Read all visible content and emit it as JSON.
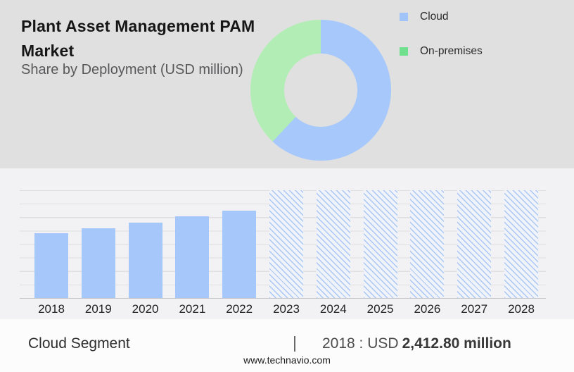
{
  "header": {
    "title": "Plant Asset Management PAM Market",
    "subtitle": "Share by Deployment (USD million)"
  },
  "footer": {
    "segment_label": "Cloud Segment",
    "separator": "|",
    "value_prefix": "2018 : USD",
    "value_bold": "2,412.80 million",
    "website": "www.technavio.com"
  },
  "palette": {
    "header_background": "#e0e0e0",
    "chart_background": "#f2f2f4",
    "footer_background": "#fcfcfc",
    "gridline": "#dfdfe2",
    "axis_baseline": "#c6c6ca"
  },
  "chart_data": [
    {
      "type": "pie",
      "subtype": "donut",
      "title": "Share by Deployment (USD million)",
      "legend_position": "right",
      "slices": [
        {
          "label": "Cloud",
          "pct": 62,
          "color": "#a6c8fb"
        },
        {
          "label": "On-premises",
          "pct": 38,
          "color": "#b3edb6"
        }
      ],
      "legend_swatch_colors": [
        "#a0c4f7",
        "#70df8e"
      ]
    },
    {
      "type": "bar",
      "title": "Plant Asset Management PAM Market by year (USD million)",
      "xlabel": "",
      "ylabel": "",
      "categories": [
        "2018",
        "2019",
        "2020",
        "2021",
        "2022",
        "2023",
        "2024",
        "2025",
        "2026",
        "2027",
        "2028"
      ],
      "series": [
        {
          "name": "Cloud",
          "values": [
            2412.8,
            2600,
            2800,
            3030,
            3250,
            null,
            null,
            null,
            null,
            null,
            null
          ]
        }
      ],
      "forecast_categories": [
        "2023",
        "2024",
        "2025",
        "2026",
        "2027",
        "2028"
      ],
      "annotation": "2018 : USD 2,412.80 million",
      "ylim": [
        0,
        4000
      ],
      "grid": true,
      "bar_color": "#a5c7fa",
      "forecast_hatch_color": "#a9c7f3",
      "forecast_hatch_background": "#f0f3f9"
    }
  ]
}
